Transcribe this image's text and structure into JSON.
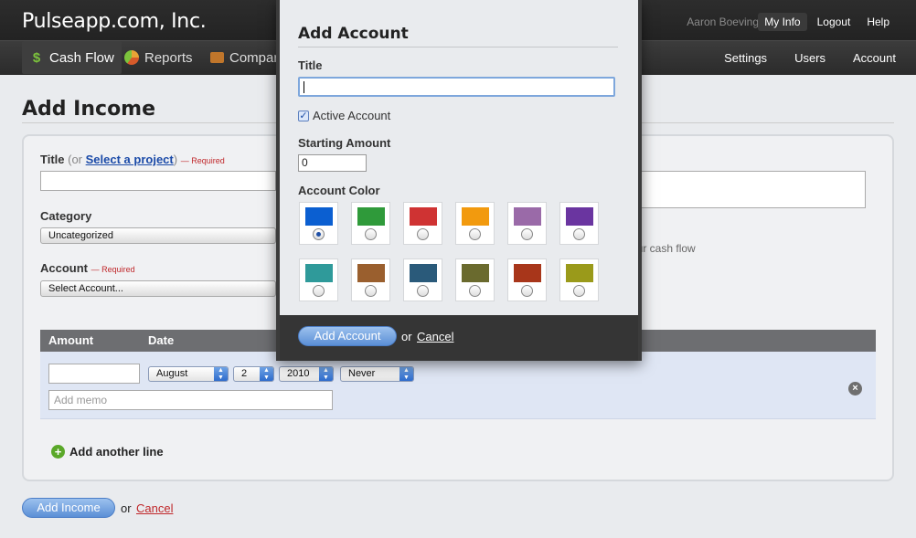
{
  "header": {
    "brand": "Pulseapp.com, Inc.",
    "user_name": "Aaron Boeving",
    "links": [
      "My Info",
      "Logout",
      "Help"
    ]
  },
  "nav": {
    "tabs": [
      {
        "label": "Cash Flow",
        "icon": "dollar-icon"
      },
      {
        "label": "Reports",
        "icon": "pie-chart-icon"
      },
      {
        "label": "Compar",
        "icon": "briefcase-icon"
      }
    ],
    "right": [
      "Settings",
      "Users",
      "Account"
    ]
  },
  "page": {
    "title": "Add Income",
    "title_label": "Title",
    "title_or": "(or",
    "select_project": "Select a project",
    "title_close": ")",
    "required": "— Required",
    "category_label": "Category",
    "category_value": "Uncategorized",
    "account_label": "Account",
    "account_value": "Select Account...",
    "hint": "our cash flow",
    "table": {
      "col_amount": "Amount",
      "col_date": "Date",
      "month": "August",
      "day": "2",
      "year": "2010",
      "repeat": "Never",
      "memo_placeholder": "Add memo"
    },
    "add_line": "Add another line",
    "submit": "Add Income",
    "or": "or",
    "cancel": "Cancel"
  },
  "modal": {
    "title": "Add Account",
    "title_label": "Title",
    "title_value": "",
    "active_label": "Active Account",
    "active_checked": true,
    "starting_label": "Starting Amount",
    "starting_value": "0",
    "color_label": "Account Color",
    "colors": [
      "#0b5fd1",
      "#2f9a3a",
      "#cf3333",
      "#f29a0e",
      "#9a6aa8",
      "#6a35a0",
      "#2f9a9a",
      "#9a5f2e",
      "#2a5a7a",
      "#6a6a2e",
      "#a8361a",
      "#9a9a1a"
    ],
    "selected_color_index": 0,
    "submit": "Add Account",
    "or": "or",
    "cancel": "Cancel"
  }
}
